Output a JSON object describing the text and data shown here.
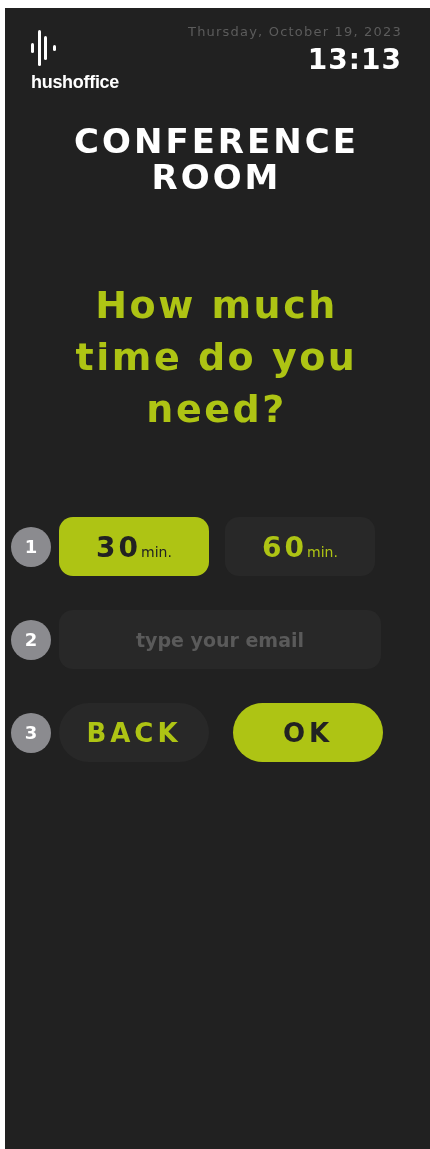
{
  "header": {
    "logo_text": "hushoffice",
    "date": "Thursday, October 19, 2023",
    "time": "13:13"
  },
  "room_title": "CONFERENCE ROOM",
  "question": "How much time do you need?",
  "steps": [
    {
      "number": "1",
      "kind": "durations",
      "options": [
        {
          "value": "30",
          "unit": "min.",
          "selected": true
        },
        {
          "value": "60",
          "unit": "min.",
          "selected": false
        }
      ]
    },
    {
      "number": "2",
      "kind": "email",
      "placeholder": "type your email"
    },
    {
      "number": "3",
      "kind": "actions",
      "buttons": [
        {
          "label": "BACK",
          "kind": "secondary"
        },
        {
          "label": "OK",
          "kind": "primary"
        }
      ]
    }
  ]
}
